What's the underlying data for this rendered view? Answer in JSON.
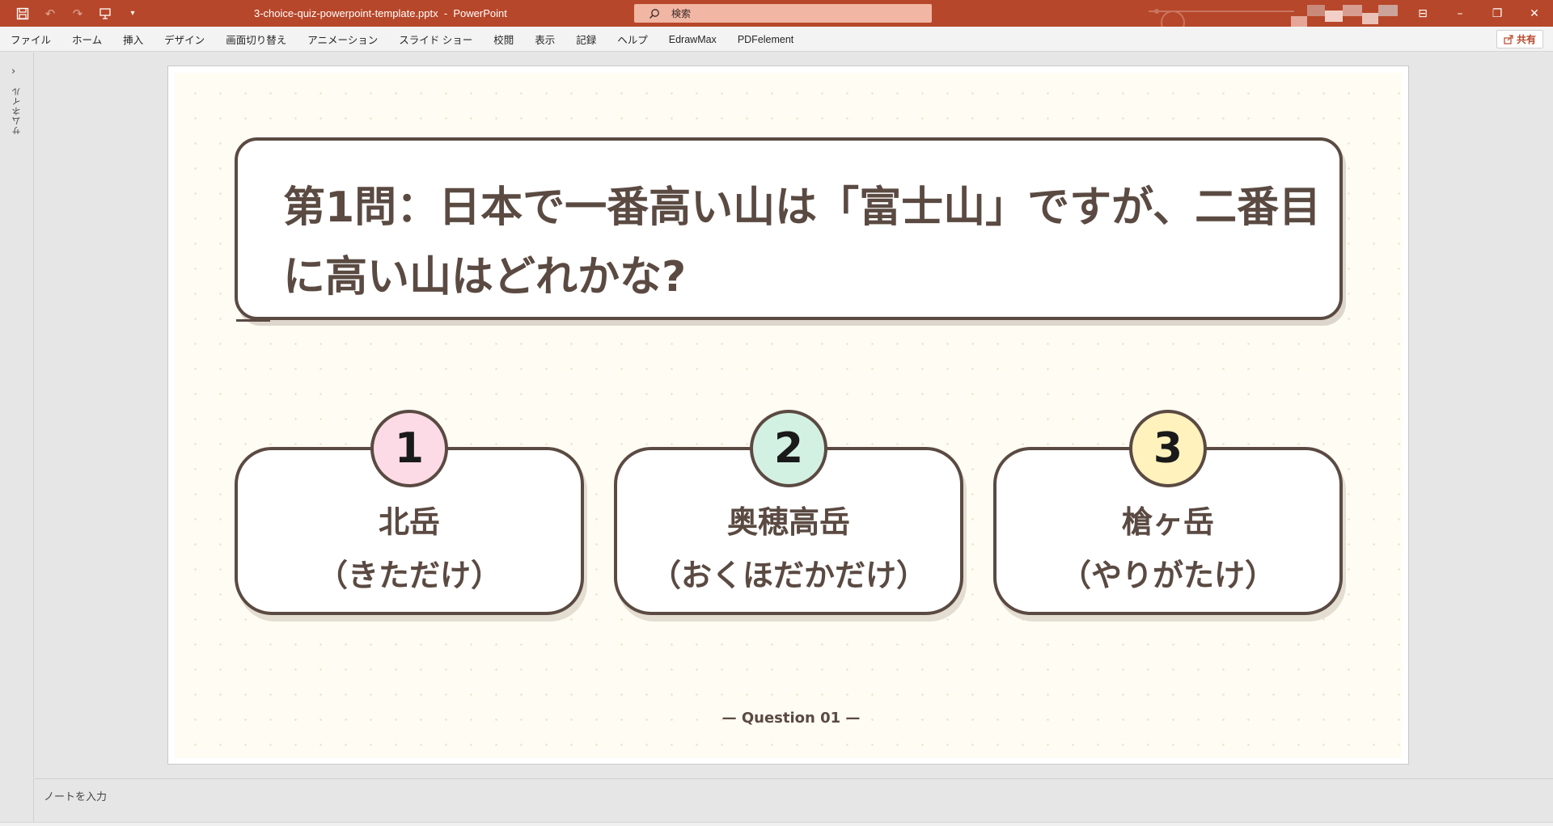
{
  "window": {
    "doc_title": "3-choice-quiz-powerpoint-template.pptx  -  PowerPoint",
    "search_placeholder": "検索",
    "minimize": "–",
    "restore": "❐",
    "close": "✕",
    "ribbon_display": "⊟"
  },
  "menu": {
    "tabs": [
      "ファイル",
      "ホーム",
      "挿入",
      "デザイン",
      "画面切り替え",
      "アニメーション",
      "スライド ショー",
      "校閲",
      "表示",
      "記録",
      "ヘルプ",
      "EdrawMax",
      "PDFelement"
    ],
    "share_label": "共有"
  },
  "leftpane": {
    "expand_glyph": "›",
    "label": "サムネイル"
  },
  "slide": {
    "question": "第1問：日本で一番高い山は「富士山」ですが、二番目に高い山はどれかな?",
    "choices": [
      {
        "number": "1",
        "name": "北岳",
        "reading": "（きただけ）",
        "badge_color": "#fddbe6"
      },
      {
        "number": "2",
        "name": "奥穂高岳",
        "reading": "（おくほだかだけ）",
        "badge_color": "#d3f1e3"
      },
      {
        "number": "3",
        "name": "槍ヶ岳",
        "reading": "（やりがたけ）",
        "badge_color": "#fff2bd"
      }
    ],
    "footer": "— Question 01 —"
  },
  "notes": {
    "placeholder": "ノートを入力"
  },
  "colors": {
    "titlebar": "#b7472a",
    "search_bg": "#f1b6a4",
    "slide_ink": "#5a4a42",
    "slide_bg": "#fffcf3"
  },
  "icons": {
    "qat": [
      "save-icon",
      "undo-icon",
      "redo-icon",
      "present-icon",
      "customize-icon"
    ]
  }
}
